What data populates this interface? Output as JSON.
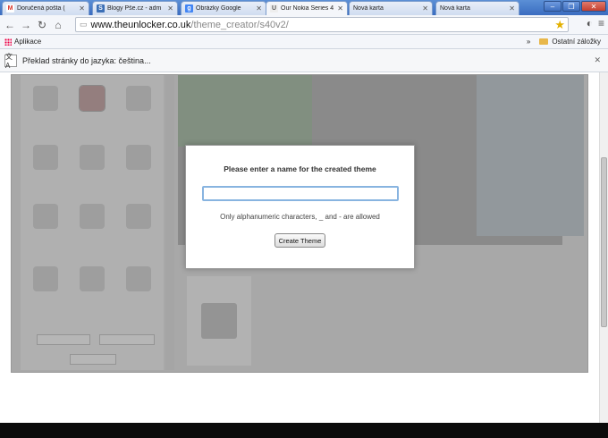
{
  "tabs": [
    {
      "label": "Doručená pošta (",
      "icon": "gmail-icon"
    },
    {
      "label": "Blogy Pše.cz - adm",
      "icon": "blog-icon"
    },
    {
      "label": "Obrázky Google",
      "icon": "google-icon"
    },
    {
      "label": "Our Nokia Series 4",
      "icon": "unlocker-icon",
      "active": true
    },
    {
      "label": "Nová karta",
      "icon": ""
    },
    {
      "label": "Nová karta",
      "icon": ""
    }
  ],
  "address": {
    "host": "www.theunlocker.co.uk",
    "path": "/theme_creator/s40v2/"
  },
  "bookmarks": {
    "apps_label": "Aplikace",
    "more": "»",
    "other_label": "Ostatní záložky"
  },
  "translate": {
    "message": "Překlad stránky do jazyka: čeština..."
  },
  "dialog": {
    "title": "Please enter a name for the created  theme",
    "input_value": "",
    "hint": "Only alphanumeric characters, _ and  - are allowed",
    "button_label": "Create Theme"
  },
  "colors": {
    "tabstrip": "#3a6cc0",
    "accent_focus": "#88b4e0",
    "star": "#e3b000"
  }
}
